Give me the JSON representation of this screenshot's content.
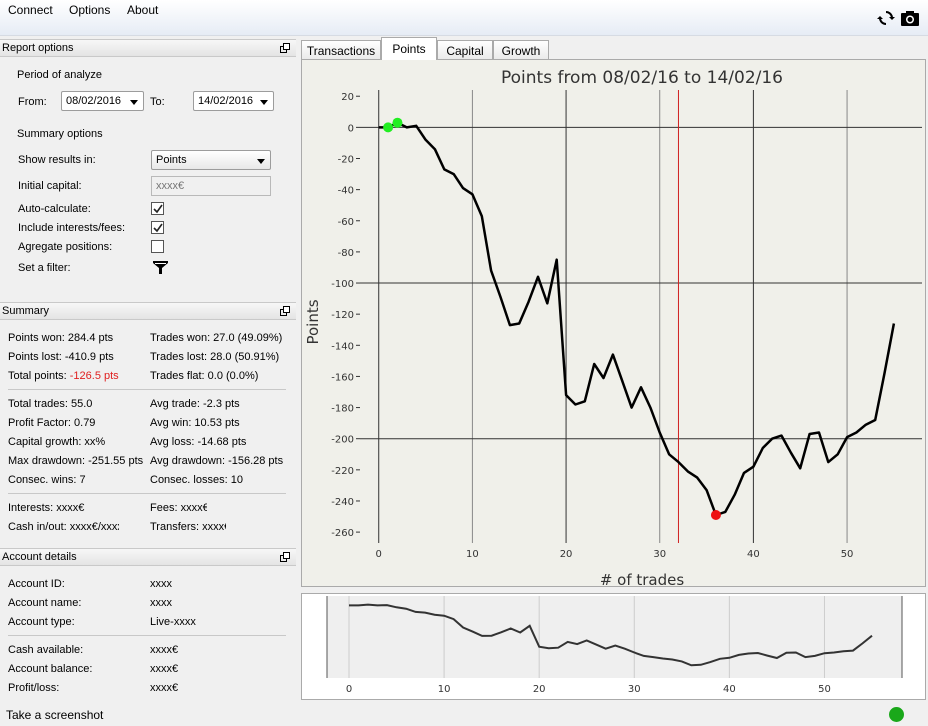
{
  "menu": [
    "Connect",
    "Options",
    "About"
  ],
  "toolbar": {
    "refresh_icon": "refresh-icon",
    "camera_icon": "camera-icon"
  },
  "report_options": {
    "header": "Report options",
    "period_label": "Period of analyze",
    "from_label": "From:",
    "from_value": "08/02/2016",
    "to_label": "To:",
    "to_value": "14/02/2016",
    "summary_label": "Summary options",
    "show_results_label": "Show results in:",
    "show_results_value": "Points",
    "initial_capital_label": "Initial capital:",
    "initial_capital_placeholder": "xxxx€",
    "auto_calc_label": "Auto-calculate:",
    "include_fees_label": "Include interests/fees:",
    "aggregate_label": "Agregate positions:",
    "filter_label": "Set a filter:",
    "auto_calc_checked": true,
    "include_fees_checked": true,
    "aggregate_checked": false
  },
  "summary": {
    "header": "Summary",
    "points_won": "Points won: 284.4 pts",
    "trades_won": "Trades won: 27.0 (49.09%)",
    "points_lost": "Points lost: -410.9 pts",
    "trades_lost": "Trades lost: 28.0 (50.91%)",
    "total_points_label": "Total points:",
    "total_points_value": "-126.5 pts",
    "trades_flat": "Trades flat: 0.0 (0.0%)",
    "total_trades": "Total trades: 55.0",
    "avg_trade": "Avg trade: -2.3 pts",
    "profit_factor": "Profit Factor: 0.79",
    "avg_win": "Avg win: 10.53 pts",
    "capital_growth": "Capital growth: xx%",
    "avg_loss": "Avg loss: -14.68 pts",
    "max_drawdown": "Max drawdown: -251.55 pts",
    "avg_drawdown": "Avg drawdown: -156.28 pts",
    "consec_wins": "Consec. wins: 7",
    "consec_losses": "Consec. losses: 10",
    "interests": "Interests: xxxx€",
    "fees": "Fees: xxxx€",
    "cash_inout": "Cash in/out: xxxx€/xxxx€",
    "transfers": "Transfers: xxxx€",
    "negative_color": "#e02020"
  },
  "account": {
    "header": "Account details",
    "rows": [
      {
        "label": "Account ID:",
        "value": "xxxx"
      },
      {
        "label": "Account name:",
        "value": "xxxx"
      },
      {
        "label": "Account type:",
        "value": "Live-xxxx"
      },
      {
        "label": "Cash available:",
        "value": "xxxx€"
      },
      {
        "label": "Account balance:",
        "value": "xxxx€"
      },
      {
        "label": "Profit/loss:",
        "value": "xxxx€"
      }
    ]
  },
  "tabs": [
    "Transactions",
    "Points",
    "Capital",
    "Growth"
  ],
  "active_tab": "Points",
  "status": {
    "screenshot_label": "Take a screenshot",
    "connection_color": "#1aa81a"
  },
  "chart_data": {
    "type": "line",
    "title": "Points from 08/02/16 to 14/02/16",
    "xlabel": "# of trades",
    "ylabel": "Points",
    "xlim": [
      -2,
      58
    ],
    "ylim": [
      -267,
      24
    ],
    "x_ticks": [
      0,
      10,
      20,
      30,
      40,
      50
    ],
    "y_ticks": [
      20,
      0,
      -20,
      -40,
      -60,
      -80,
      -100,
      -120,
      -140,
      -160,
      -180,
      -200,
      -220,
      -240,
      -260
    ],
    "grid": true,
    "x": [
      0,
      1,
      2,
      3,
      4,
      5,
      6,
      7,
      8,
      9,
      10,
      11,
      12,
      13,
      14,
      15,
      16,
      17,
      18,
      19,
      20,
      21,
      22,
      23,
      24,
      25,
      26,
      27,
      28,
      29,
      30,
      31,
      32,
      33,
      34,
      35,
      36,
      37,
      38,
      39,
      40,
      41,
      42,
      43,
      44,
      45,
      46,
      47,
      48,
      49,
      50,
      51,
      52,
      53,
      54,
      55
    ],
    "y": [
      0,
      0,
      3,
      0,
      1,
      -8,
      -14,
      -27,
      -30,
      -39,
      -43,
      -57,
      -92,
      -109,
      -127,
      -126,
      -112,
      -96,
      -113,
      -85,
      -172,
      -178,
      -176,
      -152,
      -161,
      -146,
      -163,
      -180,
      -167,
      -180,
      -196,
      -210,
      -215,
      -221,
      -225,
      -233,
      -249,
      -247,
      -236,
      -222,
      -218,
      -206,
      -200,
      -198,
      -209,
      -219,
      -197,
      -196,
      -215,
      -210,
      -199,
      -196,
      -191,
      -188,
      -158,
      -126
    ],
    "vertical_marker_x": 32,
    "highlight_max": [
      [
        1,
        0
      ],
      [
        2,
        3
      ]
    ],
    "highlight_min": [
      [
        36,
        -249
      ]
    ],
    "line_color": "#000000",
    "marker_line_color": "#d02020",
    "max_marker_color": "#22ee22",
    "min_marker_color": "#ee1111"
  },
  "navigator": {
    "x_ticks": [
      0,
      10,
      20,
      30,
      40,
      50
    ],
    "line_color": "#333333"
  }
}
